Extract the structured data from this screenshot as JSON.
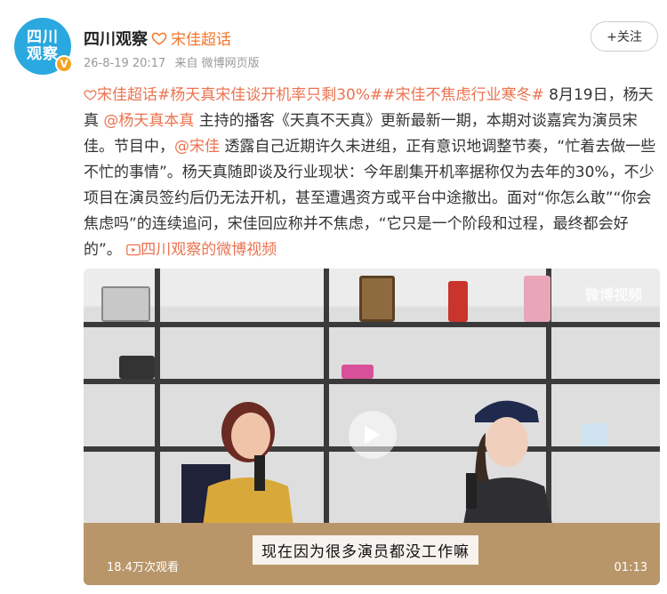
{
  "header": {
    "avatar_text_line1": "四川",
    "avatar_text_line2": "观察",
    "verified_badge": "V",
    "account_name": "四川观察",
    "super_topic": "宋佳超话",
    "timestamp": "26-8-19 20:17",
    "source": "来自 微博网页版",
    "follow_label": "+关注"
  },
  "post": {
    "super_topic_link": "宋佳超话",
    "hashtags": "#杨天真宋佳谈开机率只剩30%##宋佳不焦虑行业寒冬#",
    "text_1": " 8月19日，杨天真",
    "mention_1": "@杨天真本真",
    "text_2": " 主持的播客《天真不天真》更新最新一期，本期对谈嘉宾为演员宋佳。节目中，",
    "mention_2": "@宋佳",
    "text_3": " 透露自己近期许久未进组，正有意识地调整节奏，“忙着去做一些不忙的事情”。杨天真随即谈及行业现状：今年剧集开机率据称仅为去年的30%，不少项目在演员签约后仍无法开机，甚至遭遇资方或平台中途撤出。面对“你怎么敢”“你会焦虑吗”的连续追问，宋佳回应称并不焦虑，“它只是一个阶段和过程，最终都会好的”。",
    "video_link": "四川观察的微博视频"
  },
  "video": {
    "watermark": "微博视频",
    "subtitle": "现在因为很多演员都没工作嘛",
    "views": "18.4万次观看",
    "duration": "01:13"
  },
  "colors": {
    "accent": "#eb7350",
    "avatar_blue": "#2aa8e0",
    "verified_gold": "#f2a31f"
  }
}
